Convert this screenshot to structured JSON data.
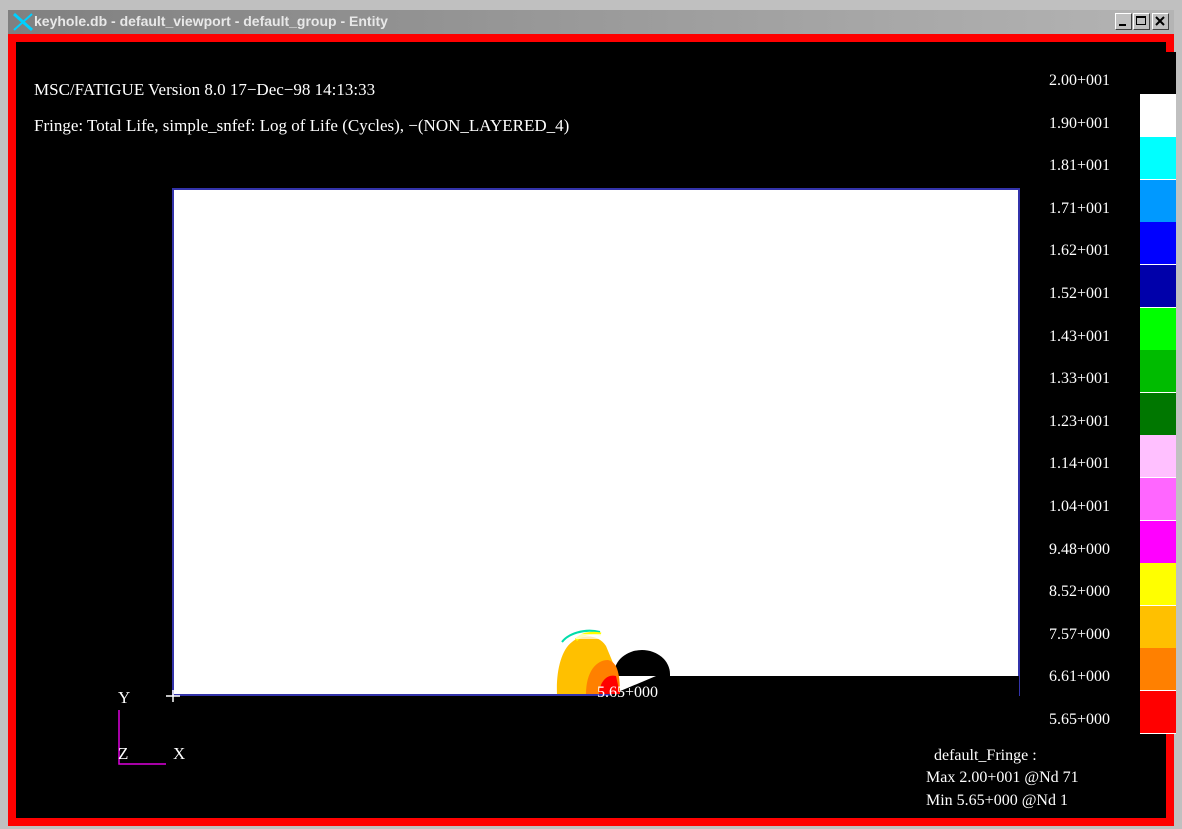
{
  "window": {
    "title": "keyhole.db - default_viewport - default_group - Entity"
  },
  "viewport": {
    "header_line1": "MSC/FATIGUE Version 8.0 17−Dec−98 14:13:33",
    "header_line2": "Fringe: Total Life, simple_snfef: Log of Life (Cycles), −(NON_LAYERED_4)",
    "min_marker_label": "5.65+000",
    "axes": {
      "y": "Y",
      "z": "Z",
      "x": "X"
    },
    "fringe_info": {
      "name": "default_Fringe :",
      "max": "Max 2.00+001 @Nd 71",
      "min": "Min 5.65+000 @Nd 1"
    }
  },
  "legend": {
    "labels": [
      "2.00+001",
      "1.90+001",
      "1.81+001",
      "1.71+001",
      "1.62+001",
      "1.52+001",
      "1.43+001",
      "1.33+001",
      "1.23+001",
      "1.14+001",
      "1.04+001",
      "9.48+000",
      "8.52+000",
      "7.57+000",
      "6.61+000",
      "5.65+000"
    ],
    "colors": [
      "#000000",
      "#ffffff",
      "#00ffff",
      "#0099ff",
      "#0000ff",
      "#0000aa",
      "#00ff00",
      "#00bb00",
      "#007700",
      "#ffc0ff",
      "#ff66ff",
      "#ff00ff",
      "#ffff00",
      "#ffc000",
      "#ff8000",
      "#ff0000"
    ]
  },
  "colors": {
    "frame": "#ff0000",
    "background": "#000000",
    "model": "#ffffff"
  }
}
